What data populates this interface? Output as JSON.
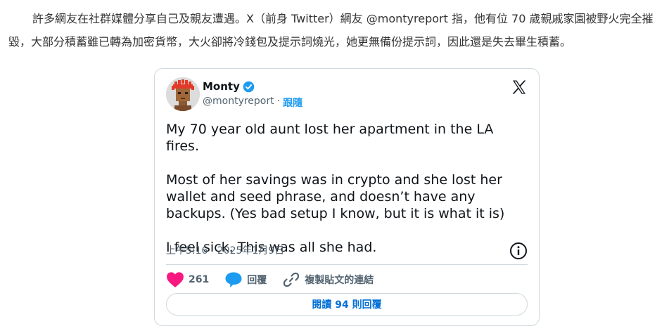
{
  "article": {
    "paragraph": "許多網友在社群媒體分享自己及親友遭遇。X（前身 Twitter）網友 @montyreport 指，他有位 70 歲親戚家園被野火完全摧毀，大部分積蓄雖已轉為加密貨幣，大火卻將冷錢包及提示詞燒光，她更無備份提示詞，因此還是失去畢生積蓄。"
  },
  "tweet": {
    "author_name": "Monty",
    "handle": "@montyreport",
    "separator": "·",
    "follow_label": "跟隨",
    "body": [
      "My 70 year old aunt lost her apartment in the LA fires.",
      "Most of her savings was in crypto and she lost her wallet and seed phrase, and doesn’t have any backups. (Yes bad setup I know, but it is what it is)",
      "I feel sick. This was all she had."
    ],
    "timestamp": "上午5:16 · 2025年1月9日",
    "likes_count": "261",
    "reply_label": "回覆",
    "copy_link_label": "複製貼文的連結",
    "read_replies_label": "閱讀 94 則回覆",
    "icons": {
      "verified": "verified-badge-icon",
      "logo": "x-logo-icon",
      "info": "info-icon",
      "like": "heart-icon",
      "reply": "speech-bubble-icon",
      "link": "link-icon"
    },
    "colors": {
      "accent": "#1d9bf0",
      "like": "#f91880",
      "text": "#0f1419",
      "muted": "#536471",
      "link_text": "#006fd6"
    }
  }
}
